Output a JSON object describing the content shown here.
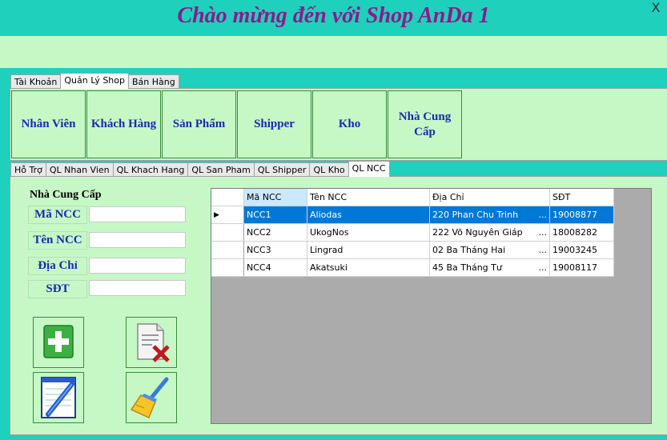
{
  "window": {
    "title": "Chào mừng đến với Shop AnDa 1",
    "close_symbol": "X"
  },
  "top_tabs": [
    {
      "label": "Tài Khoản"
    },
    {
      "label": "Quản Lý Shop"
    },
    {
      "label": "Bán Hàng"
    }
  ],
  "nav_buttons": [
    {
      "label": "Nhân Viên"
    },
    {
      "label": "Khách Hàng"
    },
    {
      "label": "Sản Phẩm"
    },
    {
      "label": "Shipper"
    },
    {
      "label": "Kho"
    },
    {
      "label": "Nhà Cung Cấp"
    }
  ],
  "sub_tabs": [
    {
      "label": "Hỗ Trợ"
    },
    {
      "label": "QL Nhan Vien"
    },
    {
      "label": "QL Khach Hang"
    },
    {
      "label": "QL San Pham"
    },
    {
      "label": "QL Shipper"
    },
    {
      "label": "QL Kho"
    },
    {
      "label": "QL NCC"
    }
  ],
  "form": {
    "group_title": "Nhà Cung Cấp",
    "fields": [
      {
        "label": "Mã NCC",
        "value": ""
      },
      {
        "label": "Tên NCC",
        "value": ""
      },
      {
        "label": "Địa Chỉ",
        "value": ""
      },
      {
        "label": "SĐT",
        "value": ""
      }
    ]
  },
  "actions": {
    "add_icon": "add-icon",
    "delete_icon": "delete-document-icon",
    "edit_icon": "notepad-edit-icon",
    "clear_icon": "broom-icon"
  },
  "grid": {
    "row_indicator": "▶",
    "columns": [
      "Mã NCC",
      "Tên NCC",
      "Địa Chỉ",
      "SĐT"
    ],
    "rows": [
      {
        "ma": "NCC1",
        "ten": "Aliodas",
        "diachi": "220 Phan Chu Trinh",
        "sdt": "19008877",
        "selected": true
      },
      {
        "ma": "NCC2",
        "ten": "UkogNos",
        "diachi": "222 Võ Nguyên Giáp",
        "sdt": "18008282",
        "selected": false
      },
      {
        "ma": "NCC3",
        "ten": "Lingrad",
        "diachi": "02 Ba Tháng Hai",
        "sdt": "19003245",
        "selected": false
      },
      {
        "ma": "NCC4",
        "ten": "Akatsuki",
        "diachi": "45 Ba Tháng Tư",
        "sdt": "19008117",
        "selected": false
      }
    ],
    "ellipsis": "..."
  },
  "colors": {
    "background": "#1fd0bd",
    "panel": "#c6f8c6",
    "title": "#8b1b8b",
    "button_text": "#1a2ab0",
    "selection": "#0078d7"
  }
}
